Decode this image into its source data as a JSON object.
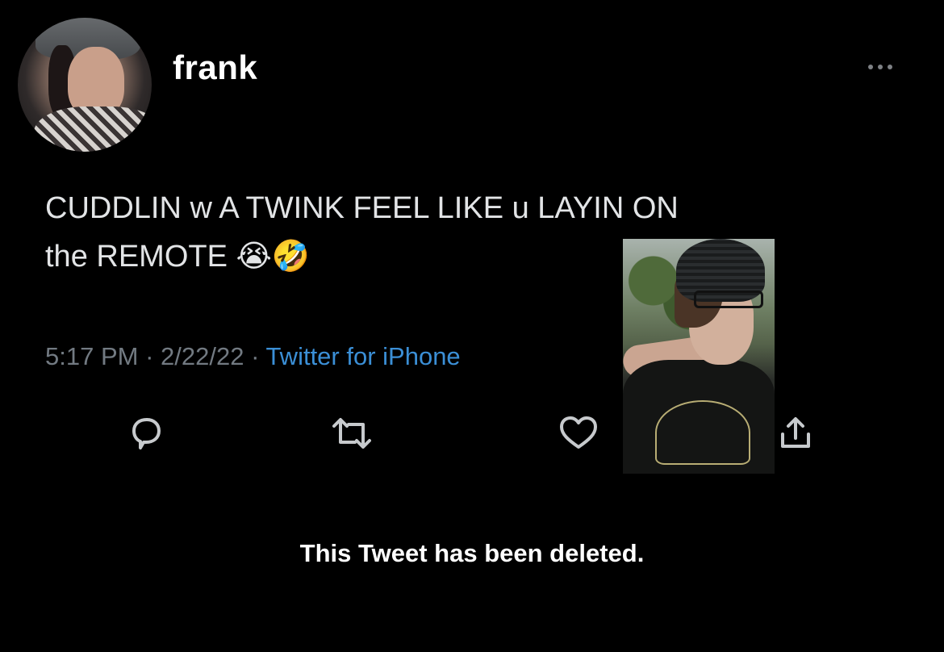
{
  "user": {
    "name": "frank"
  },
  "tweet": {
    "text": "CUDDLIN w A TWINK FEEL LIKE u LAYIN ON\nthe REMOTE 😭🤣",
    "time": "5:17 PM",
    "date": "2/22/22",
    "separator": " · ",
    "source": "Twitter for iPhone"
  },
  "actions": {
    "reply_icon": "reply-icon",
    "retweet_icon": "retweet-icon",
    "like_icon": "heart-icon",
    "share_icon": "share-icon"
  },
  "status": {
    "deleted_message": "This Tweet has been deleted."
  },
  "colors": {
    "background": "#000000",
    "text": "#e7e9ea",
    "muted": "#727a82",
    "link": "#3b8fd6"
  }
}
